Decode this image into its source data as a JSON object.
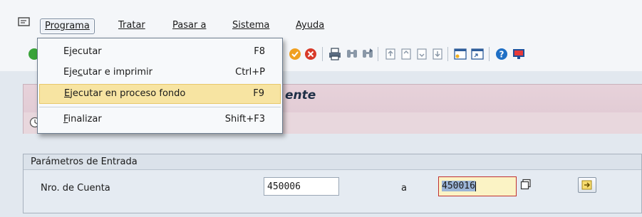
{
  "menubar": {
    "items": [
      {
        "label": "Programa",
        "active": true
      },
      {
        "label": "Tratar"
      },
      {
        "label": "Pasar a"
      },
      {
        "label": "Sistema"
      },
      {
        "label": "Ayuda"
      }
    ]
  },
  "toolbar": {
    "icons": [
      "execute-green-icon",
      "orange-cancel-icon",
      "red-exit-icon",
      "print-icon",
      "find-icon",
      "find-next-icon",
      "first-page-icon",
      "previous-page-icon",
      "next-page-icon",
      "last-page-icon",
      "create-session-icon",
      "shortcut-icon",
      "help-icon",
      "customize-layout-icon"
    ]
  },
  "dropdown": {
    "items": [
      {
        "pre": "E",
        "u": "j",
        "post": "ecutar",
        "accel": "F8",
        "highlighted": false
      },
      {
        "pre": "Eje",
        "u": "c",
        "post": "utar e imprimir",
        "accel": "Ctrl+P",
        "highlighted": false
      },
      {
        "pre": "",
        "u": "E",
        "post": "jecutar en proceso fondo",
        "accel": "F9",
        "highlighted": true
      },
      {
        "pre": "",
        "u": "F",
        "post": "inalizar",
        "accel": "Shift+F3",
        "highlighted": false
      }
    ]
  },
  "page": {
    "title_fragment": "ente"
  },
  "params": {
    "title": "Parámetros de Entrada",
    "field_label": "Nro. de Cuenta",
    "from_value": "450006",
    "range_label": "a",
    "to_value": "450016"
  },
  "colors": {
    "highlight": "#f7e4a2",
    "title_band": "#e5cfd8",
    "required_border": "#c03030"
  }
}
